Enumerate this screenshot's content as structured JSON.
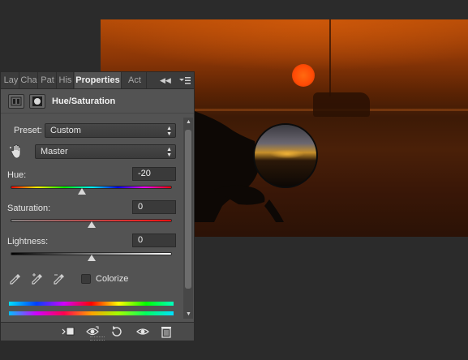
{
  "panel": {
    "tabs": [
      {
        "label": "Lay",
        "active": false
      },
      {
        "label": "Cha",
        "active": false
      },
      {
        "label": "Pat",
        "active": false
      },
      {
        "label": "His",
        "active": false
      },
      {
        "label": "Properties",
        "active": true
      },
      {
        "label": "Act",
        "active": false
      }
    ],
    "title": "Hue/Saturation",
    "preset_label": "Preset:",
    "preset_value": "Custom",
    "channel_value": "Master",
    "hue": {
      "label": "Hue:",
      "value": "-20",
      "slider_fraction": 0.444
    },
    "saturation": {
      "label": "Saturation:",
      "value": "0",
      "slider_fraction": 0.5
    },
    "lightness": {
      "label": "Lightness:",
      "value": "0",
      "slider_fraction": 0.5
    },
    "colorize_label": "Colorize",
    "colorize_checked": false
  },
  "icons": {
    "collapse": "double-chevron-left-icon",
    "panel_menu": "panel-menu-icon",
    "adjustment": "adjustment-layer-icon",
    "mask": "layer-mask-icon",
    "hand": "targeted-adjustment-hand-icon",
    "eyedropper": "eyedropper-icon",
    "eyedropper_add": "eyedropper-add-icon",
    "eyedropper_subtract": "eyedropper-subtract-icon",
    "clip": "clip-to-layer-icon",
    "view_previous": "view-previous-state-icon",
    "reset": "reset-icon",
    "visibility": "eye-icon",
    "delete": "trash-icon"
  },
  "colors": {
    "panel_bg": "#535353",
    "tabbar_bg": "#3c3c3c",
    "canvas_bg": "#2b2b2b"
  }
}
